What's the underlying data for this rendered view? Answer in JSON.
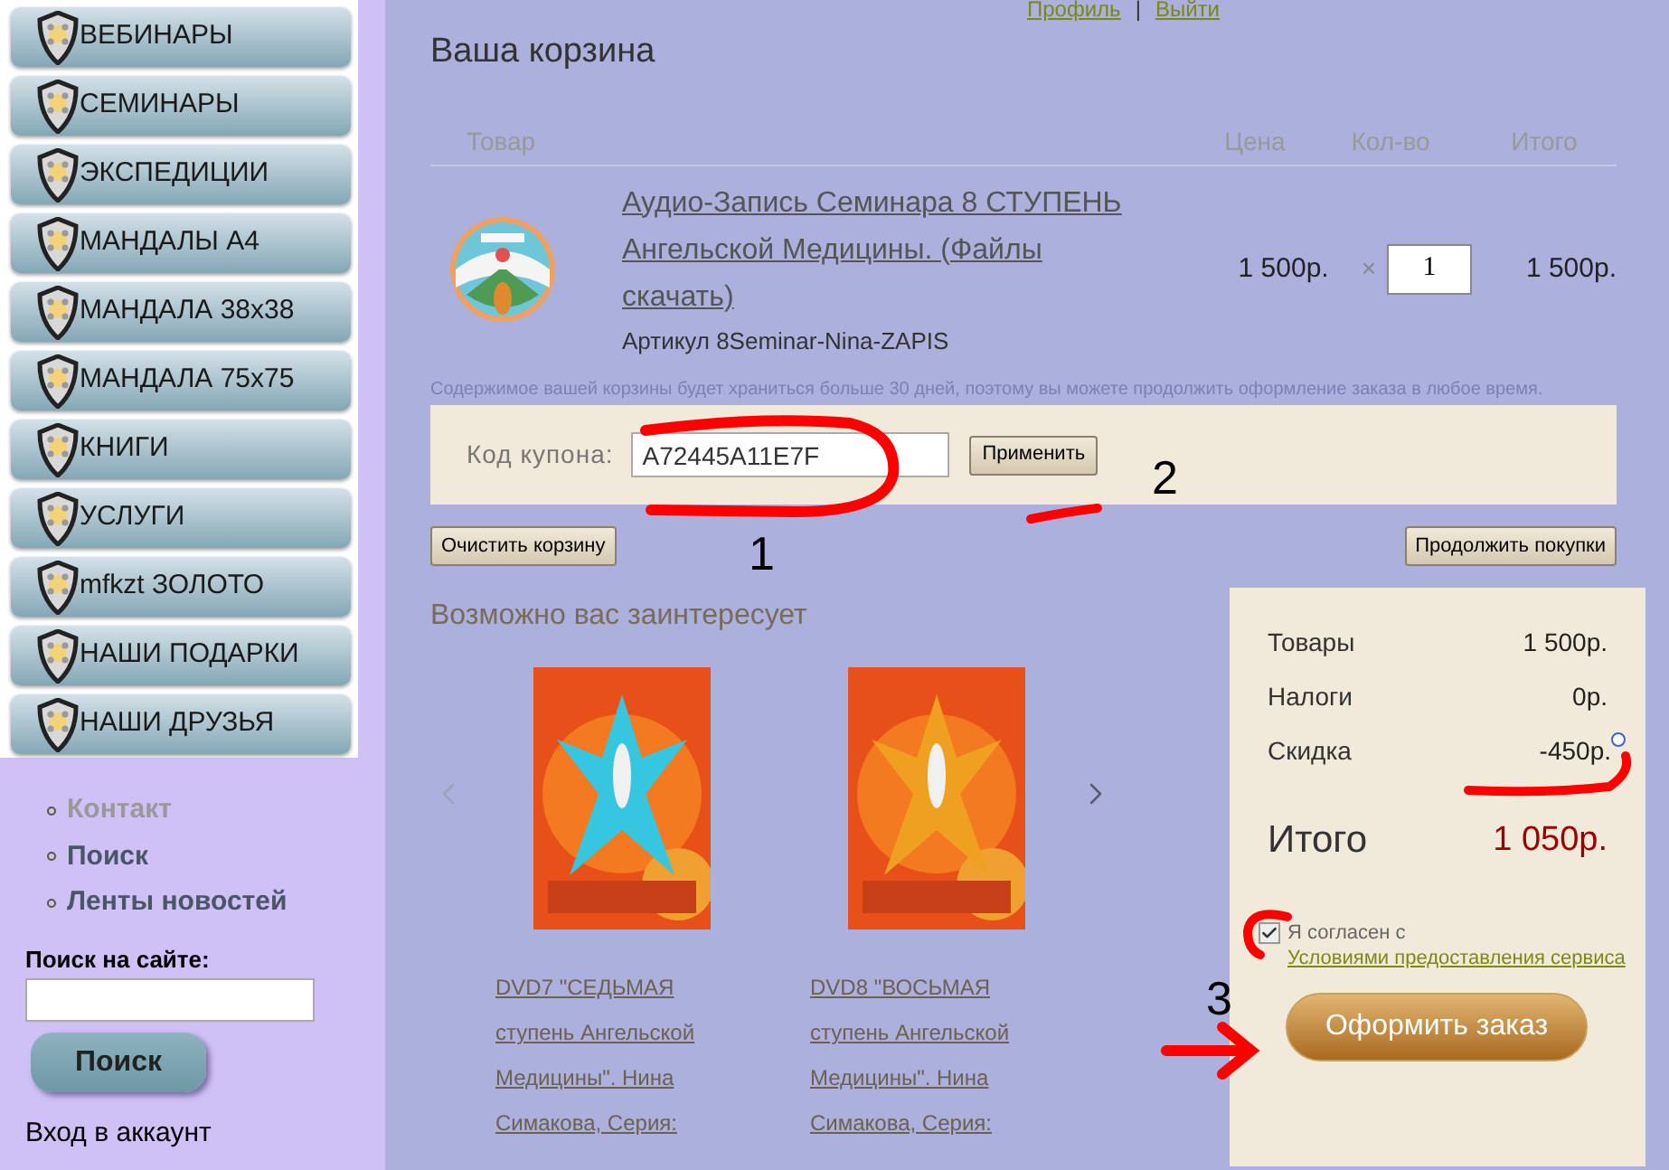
{
  "nav_menu": [
    {
      "label": "ВЕБИНАРЫ"
    },
    {
      "label": "СЕМИНАРЫ"
    },
    {
      "label": "ЭКСПЕДИЦИИ"
    },
    {
      "label": "МАНДАЛЫ А4"
    },
    {
      "label": "МАНДАЛА 38x38"
    },
    {
      "label": "МАНДАЛА 75x75"
    },
    {
      "label": "КНИГИ"
    },
    {
      "label": "УСЛУГИ"
    },
    {
      "label": "mfkzt ЗОЛОТО"
    },
    {
      "label": "НАШИ ПОДАРКИ"
    },
    {
      "label": "НАШИ ДРУЗЬЯ"
    }
  ],
  "links": [
    {
      "label": "Контакт",
      "selected": true
    },
    {
      "label": "Поиск",
      "selected": false
    },
    {
      "label": "Ленты новостей",
      "selected": false
    }
  ],
  "site_search": {
    "label": "Поиск на сайте:",
    "button": "Поиск"
  },
  "login_link": "Вход в аккаунт",
  "top_links": {
    "profile": "Профиль",
    "separator": "|",
    "logout": "Выйти"
  },
  "cart": {
    "title": "Ваша корзина",
    "columns": [
      "Товар",
      "Цена",
      "Кол-во",
      "Итого"
    ],
    "items": [
      {
        "name": "Аудио-Запись Семинара 8 СТУПЕНЬ Ангельской Медицины. (Файлы скачать)",
        "sku": "Артикул 8Seminar-Nina-ZAPIS",
        "price": "1 500р.",
        "times": "×",
        "quantity": "1",
        "total": "1 500р."
      }
    ],
    "note": "Содержимое вашей корзины будет храниться больше 30 дней, поэтому вы можете продолжить оформление заказа в любое время.",
    "coupon": {
      "label": "Код купона:",
      "value": "A72445A11E7F",
      "button": "Применить"
    },
    "clear_button": "Очистить корзину",
    "continue_button": "Продолжить покупки"
  },
  "recommendations": {
    "title": "Возможно вас заинтересует",
    "items": [
      {
        "caption": "DVD7 \"СЕДЬМАЯ ступень Ангельской Медицины\". Нина Симакова, Серия:"
      },
      {
        "caption": "DVD8 \"ВОСЬМАЯ ступень Ангельской Медицины\". Нина Симакова, Серия:"
      }
    ]
  },
  "summary": {
    "rows": [
      {
        "label": "Товары",
        "value": "1 500р.",
        "help": false
      },
      {
        "label": "Налоги",
        "value": "0р.",
        "help": false
      },
      {
        "label": "Скидка",
        "value": "-450р.",
        "help": true
      }
    ],
    "total": {
      "label": "Итого",
      "value": "1 050р."
    },
    "agree": {
      "checked": true,
      "text": "Я согласен с",
      "link": "Условиями предоставления сервиса"
    },
    "checkout_button": "Оформить заказ"
  },
  "annotations": [
    "1",
    "2",
    "3"
  ]
}
